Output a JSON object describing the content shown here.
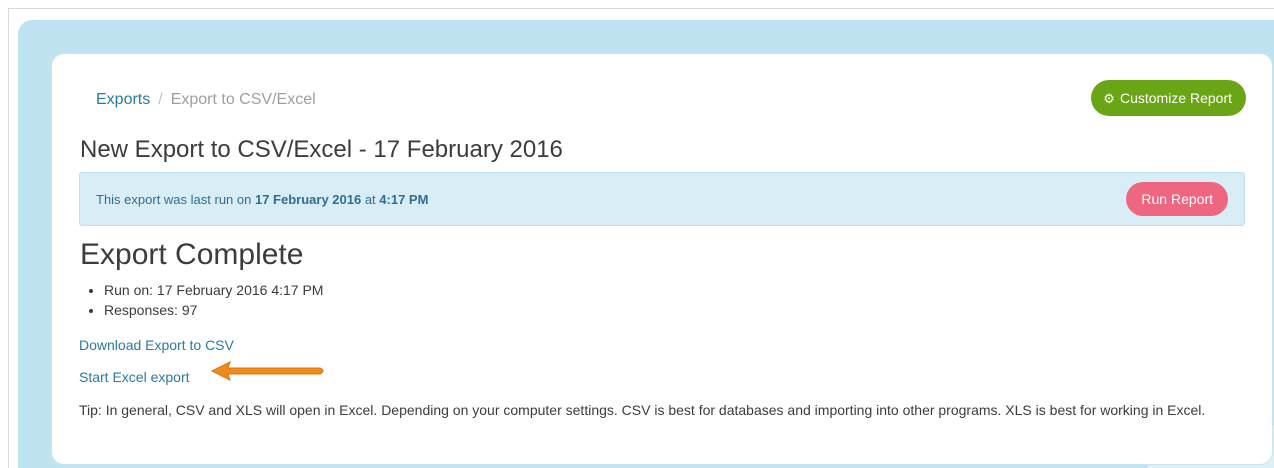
{
  "breadcrumb": {
    "parent": "Exports",
    "separator": "/",
    "current": "Export to CSV/Excel"
  },
  "header": {
    "customize_label": "Customize Report",
    "customize_icon": "gear-icon",
    "customize_color": "#6aa516"
  },
  "title": "New Export to CSV/Excel - 17 February 2016",
  "info": {
    "prefix": "This export was last run on ",
    "date": "17 February 2016",
    "middle": " at ",
    "time": "4:17 PM",
    "run_label": "Run Report",
    "run_color": "#ee6680"
  },
  "result": {
    "heading": "Export Complete",
    "details": [
      "Run on: 17 February 2016 4:17 PM",
      "Responses: 97"
    ],
    "download_csv": "Download Export to CSV",
    "start_excel": "Start Excel export",
    "annotation": "arrow-icon",
    "annotation_color": "#f08a1c"
  },
  "tip": "Tip: In general, CSV and XLS will open in Excel. Depending on your computer settings. CSV is best for databases and importing into other programs. XLS is best for working in Excel."
}
